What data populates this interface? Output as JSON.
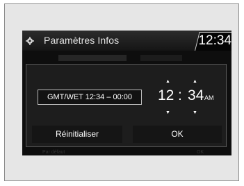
{
  "header": {
    "icon": "gear-icon",
    "title": "Paramètres Infos",
    "clock": "12:34"
  },
  "background": {
    "bottom_left_label": "Par défaut",
    "bottom_right_label": "OK"
  },
  "dialog": {
    "timezone_label": "GMT/WET 12:34 – 00:00",
    "time": {
      "hour": "12",
      "separator": ":",
      "minute": "34",
      "ampm": "AM",
      "up_glyph": "▲",
      "down_glyph": "▼"
    },
    "reset_button": "Réinitialiser",
    "ok_button": "OK"
  },
  "colors": {
    "screen_bg": "#0e0e0e",
    "dialog_bg": "#1d1d1d",
    "text": "#ffffff"
  }
}
